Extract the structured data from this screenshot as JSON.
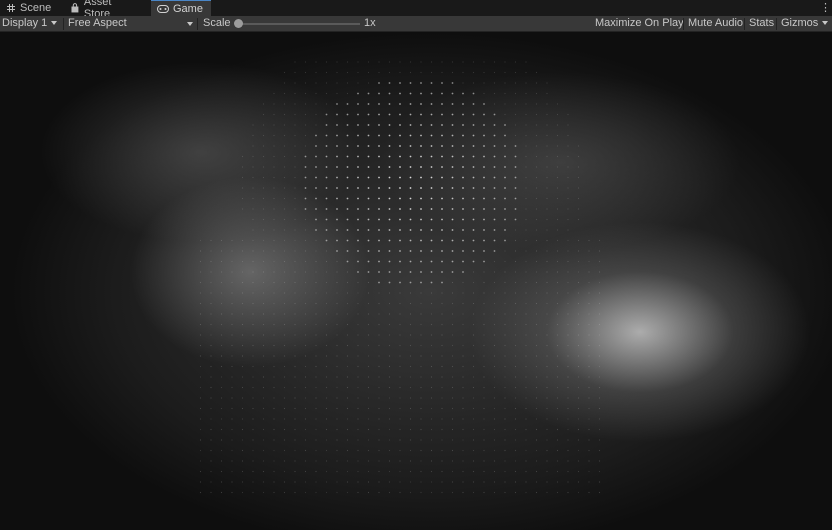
{
  "tabs": [
    {
      "label": "Scene",
      "icon": "grid-icon",
      "active": false
    },
    {
      "label": "Asset Store",
      "icon": "shopping-bag-icon",
      "active": false
    },
    {
      "label": "Game",
      "icon": "gamepad-icon",
      "active": true
    }
  ],
  "toolbar": {
    "display": "Display 1",
    "aspect": "Free Aspect",
    "scale_label": "Scale",
    "scale_value": "1x",
    "maximize": "Maximize On Play",
    "mute": "Mute Audio",
    "stats": "Stats",
    "gizmos": "Gizmos"
  },
  "colors": {
    "accent": "#4a86c7",
    "toolbar": "#383838",
    "tabbar": "#191919"
  }
}
